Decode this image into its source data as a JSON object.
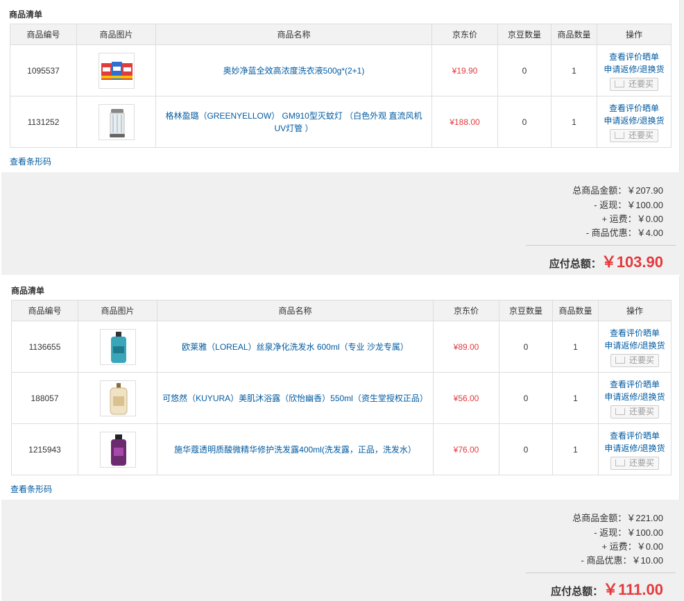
{
  "columns": [
    "商品编号",
    "商品图片",
    "商品名称",
    "京东价",
    "京豆数量",
    "商品数量",
    "操作"
  ],
  "ops": {
    "review": "查看评价晒单",
    "service": "申请返修/退换货",
    "rebuy": "还要买"
  },
  "barcode_link": "查看条形码",
  "orders": [
    {
      "title": "商品清单",
      "items": [
        {
          "id": "1095537",
          "name": "奥妙净蓝全效高浓度洗衣液500g*(2+1)",
          "price": "¥19.90",
          "beans": "0",
          "qty": "1",
          "image": "detergent-3-pack"
        },
        {
          "id": "1131252",
          "name": "格林盈璐（GREENYELLOW） GM910型灭蚊灯 （白色外观 直流风机 UV灯管 ）",
          "price": "¥188.00",
          "beans": "0",
          "qty": "1",
          "image": "mosquito-lamp"
        }
      ],
      "summary": {
        "goods_label": "总商品金额：",
        "goods_value": "￥207.90",
        "cashback_label": "- 返现：",
        "cashback_value": "￥100.00",
        "shipping_label": "+ 运费：",
        "shipping_value": "￥0.00",
        "discount_label": "- 商品优惠：",
        "discount_value": "￥4.00",
        "total_label": "应付总额：",
        "total_value": "￥103.90"
      }
    },
    {
      "title": "商品清单",
      "items": [
        {
          "id": "1136655",
          "name": "欧莱雅（LOREAL）丝泉净化洗发水 600ml（专业 沙龙专属）",
          "price": "¥89.00",
          "beans": "0",
          "qty": "1",
          "image": "teal-shampoo-bottle"
        },
        {
          "id": "188057",
          "name": "可悠然（KUYURA）美肌沐浴露（欣怡幽香）550ml（资生堂授权正品）",
          "price": "¥56.00",
          "beans": "0",
          "qty": "1",
          "image": "cream-bodywash-bottle"
        },
        {
          "id": "1215943",
          "name": "施华蔻透明质酸微精华修护洗发露400ml(洗发露，正品，洗发水）",
          "price": "¥76.00",
          "beans": "0",
          "qty": "1",
          "image": "purple-shampoo-bottle"
        }
      ],
      "summary": {
        "goods_label": "总商品金额：",
        "goods_value": "￥221.00",
        "cashback_label": "- 返现：",
        "cashback_value": "￥100.00",
        "shipping_label": "+ 运费：",
        "shipping_value": "￥0.00",
        "discount_label": "- 商品优惠：",
        "discount_value": "￥10.00",
        "total_label": "应付总额：",
        "total_value": "￥111.00"
      }
    }
  ],
  "colors": {
    "price": "#e4393c",
    "link": "#005aa0",
    "header_bg": "#f2f2f2",
    "summary_bg": "#f0f0f0"
  }
}
